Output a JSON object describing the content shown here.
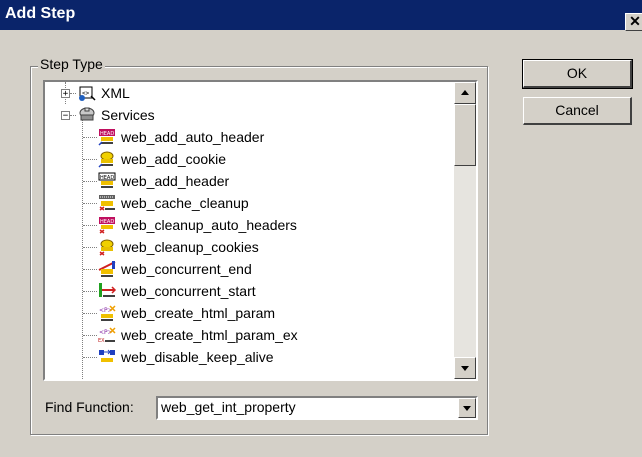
{
  "window": {
    "title": "Add Step",
    "close_glyph": "✕"
  },
  "group": {
    "label": "Step Type"
  },
  "tree": {
    "items": [
      {
        "label": "XML",
        "icon": "xml-icon",
        "expander": "+"
      },
      {
        "label": "Services",
        "icon": "services-icon",
        "expander": "−"
      },
      {
        "label": "web_add_auto_header",
        "icon": "head-icon"
      },
      {
        "label": "web_add_cookie",
        "icon": "cookie-icon"
      },
      {
        "label": "web_add_header",
        "icon": "head-icon"
      },
      {
        "label": "web_cache_cleanup",
        "icon": "cache-icon"
      },
      {
        "label": "web_cleanup_auto_headers",
        "icon": "head-icon"
      },
      {
        "label": "web_cleanup_cookies",
        "icon": "cookie-icon"
      },
      {
        "label": "web_concurrent_end",
        "icon": "concurrent-icon"
      },
      {
        "label": "web_concurrent_start",
        "icon": "concurrent-icon"
      },
      {
        "label": "web_create_html_param",
        "icon": "param-icon"
      },
      {
        "label": "web_create_html_param_ex",
        "icon": "param-icon"
      },
      {
        "label": "web_disable_keep_alive",
        "icon": "keepalive-icon"
      }
    ]
  },
  "find": {
    "label": "Find Function:",
    "value": "web_get_int_property"
  },
  "buttons": {
    "ok": "OK",
    "cancel": "Cancel"
  },
  "colors": {
    "titlebar": "#0a246a",
    "dialog": "#d4d0c8"
  }
}
